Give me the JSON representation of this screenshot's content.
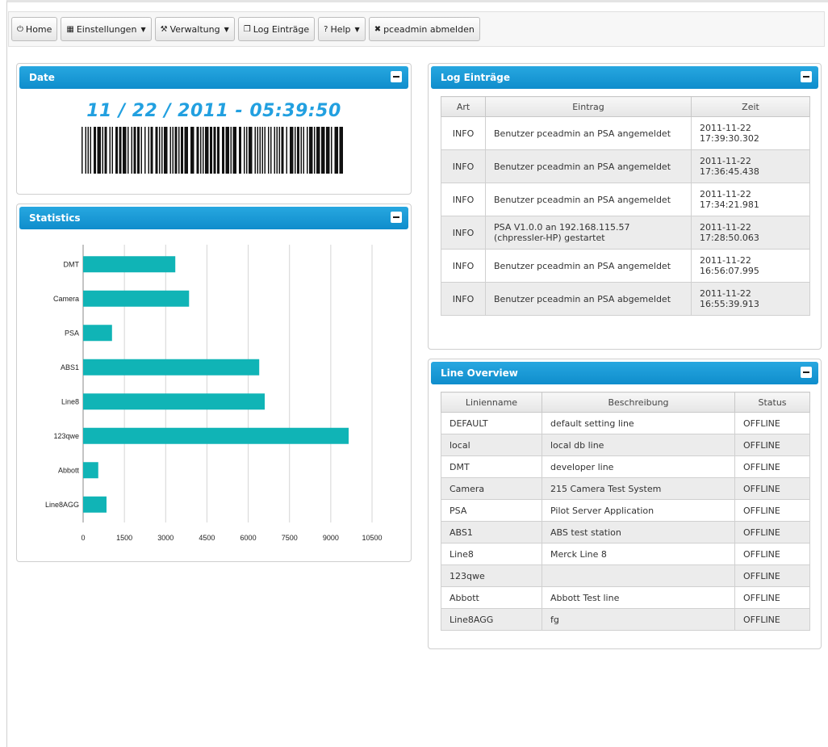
{
  "toolbar": {
    "items": [
      {
        "icon": "power-icon",
        "glyph": "⏻",
        "label": "Home",
        "caret": false
      },
      {
        "icon": "grid-icon",
        "glyph": "▦",
        "label": "Einstellungen",
        "caret": true
      },
      {
        "icon": "tools-icon",
        "glyph": "⚒",
        "label": "Verwaltung",
        "caret": true
      },
      {
        "icon": "document-icon",
        "glyph": "❐",
        "label": "Log Einträge",
        "caret": false
      },
      {
        "icon": "question-icon",
        "glyph": "?",
        "label": "Help",
        "caret": true
      },
      {
        "icon": "close-icon",
        "glyph": "✖",
        "label": "pceadmin abmelden",
        "caret": false
      }
    ]
  },
  "date_panel": {
    "title": "Date",
    "value": "11 / 22 / 2011 - 05:39:50"
  },
  "statistics_panel": {
    "title": "Statistics"
  },
  "chart_data": {
    "type": "bar",
    "orientation": "horizontal",
    "categories": [
      "DMT",
      "Camera",
      "PSA",
      "ABS1",
      "Line8",
      "123qwe",
      "Abbott",
      "Line8AGG"
    ],
    "values": [
      3350,
      3850,
      1050,
      6400,
      6600,
      9650,
      550,
      850
    ],
    "xlim": [
      0,
      10500
    ],
    "xticks": [
      0,
      1500,
      3000,
      4500,
      6000,
      7500,
      9000,
      10500
    ],
    "grid": true,
    "color": "#10b4b6"
  },
  "log_panel": {
    "title": "Log Einträge",
    "headers": [
      "Art",
      "Eintrag",
      "Zeit"
    ],
    "rows": [
      {
        "art": "INFO",
        "entry": "Benutzer pceadmin an PSA angemeldet",
        "time_date": "2011-11-22",
        "time_clock": "17:39:30.302"
      },
      {
        "art": "INFO",
        "entry": "Benutzer pceadmin an PSA angemeldet",
        "time_date": "2011-11-22",
        "time_clock": "17:36:45.438"
      },
      {
        "art": "INFO",
        "entry": "Benutzer pceadmin an PSA angemeldet",
        "time_date": "2011-11-22",
        "time_clock": "17:34:21.981"
      },
      {
        "art": "INFO",
        "entry": "PSA V1.0.0 an 192.168.115.57 (chpressler-HP) gestartet",
        "time_date": "2011-11-22",
        "time_clock": "17:28:50.063"
      },
      {
        "art": "INFO",
        "entry": "Benutzer pceadmin an PSA angemeldet",
        "time_date": "2011-11-22",
        "time_clock": "16:56:07.995"
      },
      {
        "art": "INFO",
        "entry": "Benutzer pceadmin an PSA abgemeldet",
        "time_date": "2011-11-22",
        "time_clock": "16:55:39.913"
      }
    ]
  },
  "line_panel": {
    "title": "Line Overview",
    "headers": [
      "Linienname",
      "Beschreibung",
      "Status"
    ],
    "rows": [
      {
        "name": "DEFAULT",
        "desc": "default setting line",
        "status": "OFFLINE"
      },
      {
        "name": "local",
        "desc": "local db line",
        "status": "OFFLINE"
      },
      {
        "name": "DMT",
        "desc": "developer line",
        "status": "OFFLINE"
      },
      {
        "name": "Camera",
        "desc": "215 Camera Test System",
        "status": "OFFLINE"
      },
      {
        "name": "PSA",
        "desc": "Pilot Server Application",
        "status": "OFFLINE"
      },
      {
        "name": "ABS1",
        "desc": "ABS test station",
        "status": "OFFLINE"
      },
      {
        "name": "Line8",
        "desc": "Merck Line 8",
        "status": "OFFLINE"
      },
      {
        "name": "123qwe",
        "desc": "",
        "status": "OFFLINE"
      },
      {
        "name": "Abbott",
        "desc": "Abbott Test line",
        "status": "OFFLINE"
      },
      {
        "name": "Line8AGG",
        "desc": "fg",
        "status": "OFFLINE"
      }
    ]
  }
}
